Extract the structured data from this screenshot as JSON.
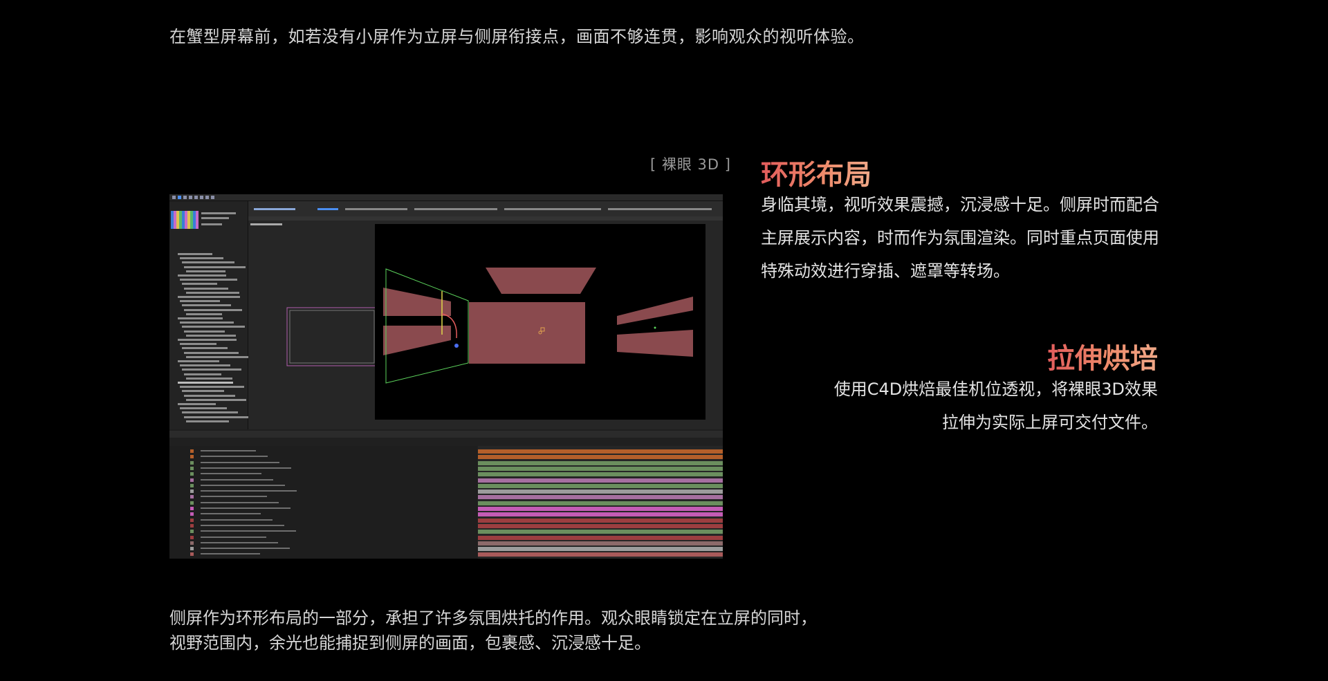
{
  "intro": "在蟹型屏幕前，如若没有小屏作为立屏与侧屏衔接点，画面不够连贯，影响观众的视听体验。",
  "tag": "[ 裸眼 3D ]",
  "section1": {
    "title": "环形布局",
    "body": "身临其境，视听效果震撼，沉浸感十足。侧屏时而配合主屏展示内容，时而作为氛围渲染。同时重点页面使用特殊动效进行穿插、遮罩等转场。"
  },
  "section2": {
    "title": "拉伸烘培",
    "body_line1": "使用C4D烘焙最佳机位透视，将裸眼3D效果",
    "body_line2": "拉伸为实际上屏可交付文件。"
  },
  "bottom": {
    "line1": "侧屏作为环形布局的一部分，承担了许多氛围烘托的作用。观众眼睛锁定在立屏的同时，",
    "line2": "视野范围内，余光也能捕捉到侧屏的画面，包裹感、沉浸感十足。"
  },
  "colors": {
    "background": "#000000",
    "heading_gradient_start": "#e25c5c",
    "heading_gradient_end": "#f0a989",
    "screen_fill": "#8a4a4e",
    "guide_line": "#5cd35c"
  },
  "timeline_bar_colors": [
    "#b45f2a",
    "#b45f2a",
    "#6b8f5e",
    "#6b8f5e",
    "#6b8f5e",
    "#a66fa0",
    "#6b8f5e",
    "#9c9c9c",
    "#a66fa0",
    "#6b8f5e",
    "#c45cb5",
    "#c45cb5",
    "#9c3e40",
    "#9c3e40",
    "#6b8f5e",
    "#9c3e40",
    "#8c6a6a",
    "#9c9c9c",
    "#a85a5a"
  ]
}
